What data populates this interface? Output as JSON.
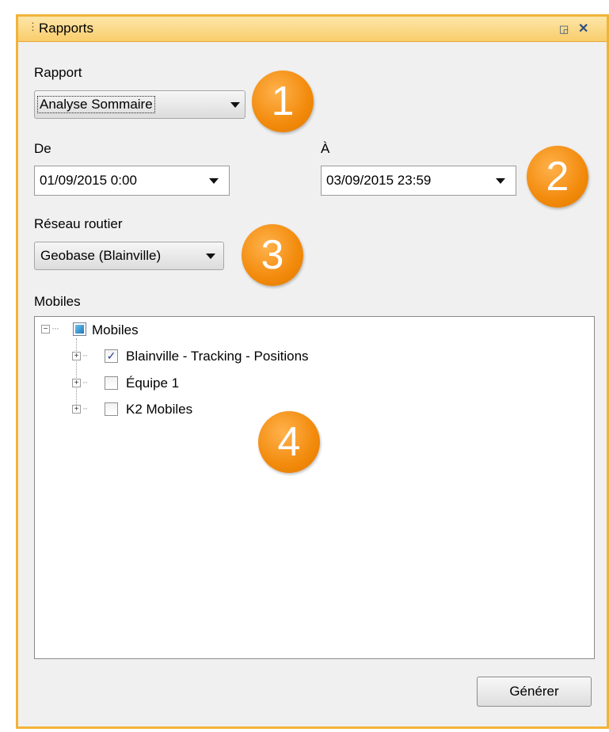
{
  "panel": {
    "title": "Rapports",
    "restore_icon": "restore-window-icon",
    "close_icon": "close-icon"
  },
  "report": {
    "label": "Rapport",
    "value": "Analyse Sommaire"
  },
  "dates": {
    "from_label": "De",
    "from_value": "01/09/2015 0:00",
    "to_label": "À",
    "to_value": "03/09/2015 23:59"
  },
  "network": {
    "label": "Réseau routier",
    "value": "Geobase (Blainville)"
  },
  "mobiles": {
    "label": "Mobiles",
    "root": {
      "label": "Mobiles",
      "expander": "−"
    },
    "children": [
      {
        "label": "Blainville - Tracking - Positions",
        "checked": true,
        "check_mark": "✓",
        "expander": "+"
      },
      {
        "label": "Équipe 1",
        "checked": false,
        "check_mark": "",
        "expander": "+"
      },
      {
        "label": "K2 Mobiles",
        "checked": false,
        "check_mark": "",
        "expander": "+"
      }
    ]
  },
  "badges": [
    "1",
    "2",
    "3",
    "4"
  ],
  "actions": {
    "generate_label": "Générer"
  },
  "colors": {
    "border": "#f2b33a",
    "badge": "#f28a0b",
    "panel_bg": "#f0f0f0"
  }
}
